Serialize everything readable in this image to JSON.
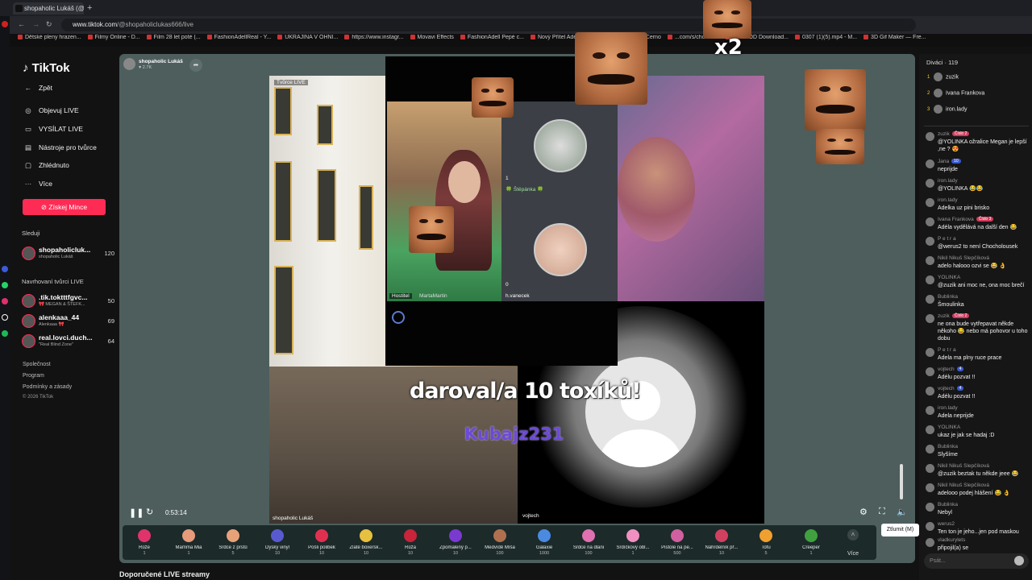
{
  "browser": {
    "tab_title": "shopaholic Lukáš (@shop",
    "new_tab": "+",
    "url_host": "www.tiktok.com",
    "url_path": "/@shopaholiclukas666/live",
    "bookmarks": [
      "Dětské pleny hrazen...",
      "Filmy Online - D...",
      "Film 28 let poté (...",
      "FashionAdellReal - Y...",
      "UKRAJINA V OHNI...",
      "https://www.instagr...",
      "Movavi Effects",
      "FashionAdell Pepé c...",
      "Nový Přítel Adély +...",
      "Fionin-blog",
      "Černo",
      "...com/s/chocho...",
      "Kick VOD Download...",
      "0307 (1)(5).mp4 - M...",
      "3D Gif Maker — Fre..."
    ]
  },
  "sidebar": {
    "logo": "TikTok",
    "nav": [
      {
        "icon": "←",
        "label": "Zpět"
      },
      {
        "icon": "◎",
        "label": "Objevuj LIVE"
      },
      {
        "icon": "▭",
        "label": "VYSÍLAT LIVE"
      },
      {
        "icon": "▤",
        "label": "Nástroje pro tvůrce"
      },
      {
        "icon": "▢",
        "label": "Zhlédnuto"
      },
      {
        "icon": "···",
        "label": "Více"
      }
    ],
    "coins_button": "Získej Mince",
    "following_title": "Sleduji",
    "following": [
      {
        "name": "shopaholicluk...",
        "sub": "shopaholic Lukáš",
        "count": "120"
      }
    ],
    "suggested_title": "Navrhovaní tvůrci LIVE",
    "suggested": [
      {
        "name": ".tik.toktttfgvc...",
        "sub": "🎀 MEGAN & ŠTEFK...",
        "count": "50"
      },
      {
        "name": "alenkaaa_44",
        "sub": "Alenkaaa 🎀",
        "count": "69"
      },
      {
        "name": "real.lovci.duch...",
        "sub": "\"Real Blind Zone\"",
        "count": "64"
      }
    ],
    "footer": [
      "Společnost",
      "Program",
      "Podmínky a zásady",
      "© 2026 TikTok"
    ]
  },
  "stream": {
    "host_name": "shopaholic Lukáš",
    "host_likes": "2.7K",
    "tvurce_live_tag": "Tvůrce LIVE",
    "cohost_label_host": "Hostitel",
    "cohost_name": "MartaMartin",
    "guest1_count": "1",
    "guest1_name": "🍀 Štěpánka 🍀",
    "guest2_count": "0",
    "guest2_name": "h.vanecek",
    "gift_text": "daroval/a 10 toxíků!",
    "gift_user": "Kubajz231",
    "combo": "x2",
    "left_label": "shopaholic Lukáš",
    "right_label": "vojtech",
    "time": "0:53:14",
    "mute_tooltip": "Ztlumit (M)"
  },
  "gifts": [
    {
      "name": "Růže",
      "price": "1",
      "color": "#e0336b"
    },
    {
      "name": "Mamma Mia",
      "price": "1",
      "color": "#e89a7a"
    },
    {
      "name": "Srdce z prstů",
      "price": "5",
      "color": "#e8a27a"
    },
    {
      "name": "Dýský vinyl",
      "price": "10",
      "color": "#5a5ad0"
    },
    {
      "name": "Pošli polibek",
      "price": "10",
      "color": "#e03050"
    },
    {
      "name": "Zlaté boxersk...",
      "price": "10",
      "color": "#e8c040"
    },
    {
      "name": "Růža",
      "price": "10",
      "color": "#c8243a"
    },
    {
      "name": "Zpomalený p...",
      "price": "10",
      "color": "#7a3ad0"
    },
    {
      "name": "Medvídě Míša",
      "price": "100",
      "color": "#b07050"
    },
    {
      "name": "Galaxie",
      "price": "1000",
      "color": "#4a8ae0"
    },
    {
      "name": "Srdce na dlani",
      "price": "100",
      "color": "#e070b0"
    },
    {
      "name": "Srdíčkový obl...",
      "price": "1",
      "color": "#f090c0"
    },
    {
      "name": "Pistole na pe...",
      "price": "500",
      "color": "#d060a0"
    },
    {
      "name": "Náhrdelník př...",
      "price": "10",
      "color": "#d04060"
    },
    {
      "name": "Tofu",
      "price": "5",
      "color": "#f0a030"
    },
    {
      "name": "Creeper",
      "price": "1",
      "color": "#40a040"
    }
  ],
  "more_label": "Více",
  "recommended_title": "Doporučené LIVE streamy",
  "viewers": {
    "title": "Diváci · 119",
    "list": [
      {
        "rank": "1",
        "name": "zuzik"
      },
      {
        "rank": "2",
        "name": "Ivana Frankova"
      },
      {
        "rank": "3",
        "name": "iron.lady"
      }
    ]
  },
  "chat": [
    {
      "user": "zuzik",
      "badge": "Číslo 2",
      "text": "@YOLINKA ožralice Megan je lepší ,ne ? 😍"
    },
    {
      "user": "Jana",
      "badge": "10",
      "blue": true,
      "text": "neprijde"
    },
    {
      "user": "iron.lady",
      "text": "@YOLINKA 😂😂"
    },
    {
      "user": "iron.lady",
      "text": "Adelka uz pini brisko"
    },
    {
      "user": "Ivana Frankova",
      "badge": "Číslo 3",
      "text": "Adéla vydělává na další den 😂"
    },
    {
      "user": "P e t r a",
      "text": "@werus2 to není Chocholousek"
    },
    {
      "user": "Nikil Nikuš Slepčíková",
      "text": "adelo halooo ozvi se 😂 👌"
    },
    {
      "user": "YOLINKA",
      "text": "@zuzik ani moc ne, ona moc brečí"
    },
    {
      "user": "Bublinka",
      "text": "Šmoulinka"
    },
    {
      "user": "zuzik",
      "badge": "Číslo 2",
      "text": "ne ona bude vytřepavat někde někoho 😂 nebo má pohovor u toho dobu"
    },
    {
      "user": "P e t r a",
      "text": "Adela ma plny ruce prace"
    },
    {
      "user": "vojtech",
      "badge": "4",
      "blue": true,
      "text": "Adélu pozvat !!"
    },
    {
      "user": "vojtech",
      "badge": "4",
      "blue": true,
      "text": "Adélu pozvat !!"
    },
    {
      "user": "iron.lady",
      "text": "Adela neprijde"
    },
    {
      "user": "YOLINKA",
      "text": "ukaz je jak se hadaj :D"
    },
    {
      "user": "Bublinka",
      "text": "Slyšíme"
    },
    {
      "user": "Nikil Nikuš Slepčíková",
      "text": "@zuzik beztak tu někde jeee 😂"
    },
    {
      "user": "Nikil Nikuš Slepčíková",
      "text": "adelooo podej hlášení 😂 👌"
    },
    {
      "user": "Bublinka",
      "text": "Nebyl"
    },
    {
      "user": "werus2",
      "text": "Ten ton je jeho...jen pod maskou"
    },
    {
      "user": "vladkurylets",
      "text": "připojil(a) se"
    }
  ],
  "chat_placeholder": "Psát..."
}
